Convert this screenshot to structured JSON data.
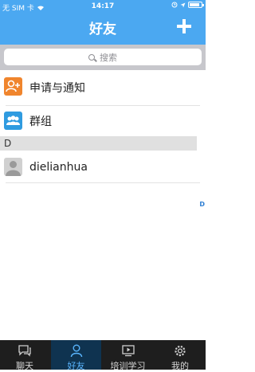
{
  "status_bar": {
    "carrier": "无 SIM 卡",
    "time": "14:17"
  },
  "header": {
    "title": "好友"
  },
  "search": {
    "placeholder": "搜索"
  },
  "rows": [
    {
      "label": "申请与通知",
      "icon": "person-add-icon",
      "color": "#f0852d"
    },
    {
      "label": "群组",
      "icon": "group-icon",
      "color": "#2f9be0"
    }
  ],
  "section": {
    "letter": "D"
  },
  "contacts": [
    {
      "name": "dielianhua",
      "icon": "avatar-placeholder-icon"
    }
  ],
  "index": {
    "letter": "D"
  },
  "tabs": [
    {
      "label": "聊天",
      "icon": "chat-icon",
      "active": false
    },
    {
      "label": "好友",
      "icon": "friends-icon",
      "active": true
    },
    {
      "label": "培训学习",
      "icon": "video-icon",
      "active": false
    },
    {
      "label": "我的",
      "icon": "gear-icon",
      "active": false
    }
  ],
  "colors": {
    "accent": "#4ba8f1",
    "tabbar": "#1e1e1e",
    "tab_active": "#5ab6ff"
  }
}
